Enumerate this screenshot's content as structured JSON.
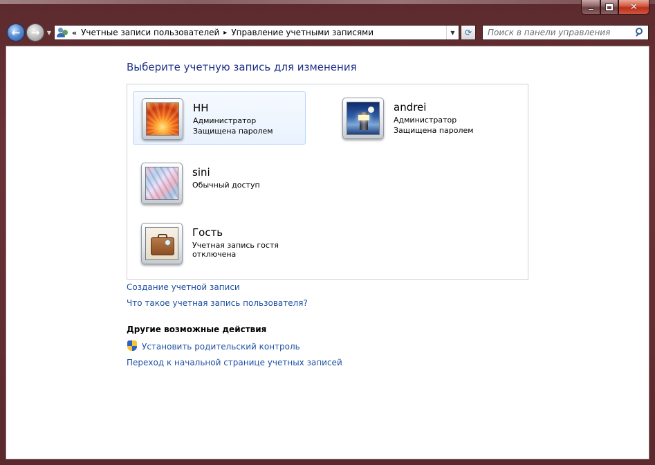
{
  "window": {
    "controls": {
      "minimize": "minimize",
      "maximize": "maximize",
      "close": "close"
    }
  },
  "nav": {
    "back_icon": "back-arrow-icon",
    "forward_icon": "forward-arrow-icon"
  },
  "address": {
    "prefix": "«",
    "crumbs": [
      "Учетные записи пользователей",
      "Управление учетными записями"
    ],
    "separator": "▸"
  },
  "search": {
    "placeholder": "Поиск в панели управления"
  },
  "main": {
    "heading": "Выберите учетную запись для изменения",
    "accounts": [
      {
        "name": "HH",
        "line1": "Администратор",
        "line2": "Защищена паролем",
        "picture": "orange-flower",
        "selected": true
      },
      {
        "name": "andrei",
        "line1": "Администратор",
        "line2": "Защищена паролем",
        "picture": "lighthouse",
        "selected": false
      },
      {
        "name": "sini",
        "line1": "Обычный доступ",
        "line2": "",
        "picture": "fabric",
        "selected": false
      },
      {
        "name": "Гость",
        "line1": "Учетная запись гостя отключена",
        "line2": "",
        "picture": "briefcase",
        "selected": false
      }
    ],
    "links": {
      "create_account": "Создание учетной записи",
      "what_is_account": "Что такое учетная запись пользователя?"
    },
    "other_actions": {
      "heading": "Другие возможные действия",
      "parental_control": "Установить родительский контроль",
      "accounts_home": "Переход к начальной странице учетных записей"
    }
  },
  "colors": {
    "heading": "#1e3287",
    "link": "#1e50a2",
    "frame": "#5c2a2e"
  }
}
